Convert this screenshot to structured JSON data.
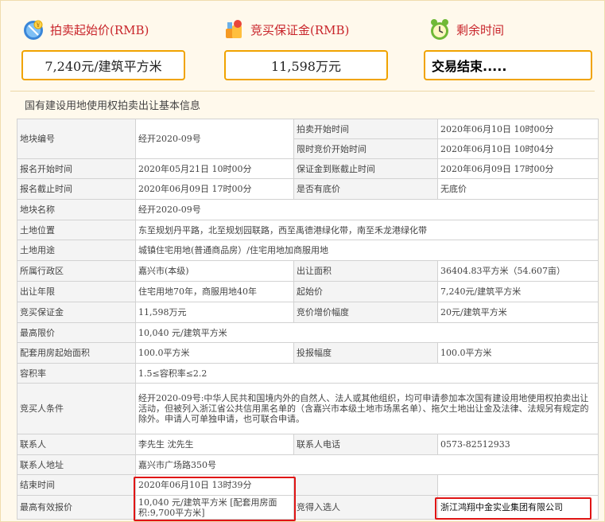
{
  "summary": {
    "start_price": {
      "label": "拍卖起始价(RMB)",
      "value": "7,240元/建筑平方米",
      "icon": "money-bag-icon"
    },
    "deposit": {
      "label": "竞买保证金(RMB)",
      "value": "11,598万元",
      "icon": "coins-icon"
    },
    "remaining": {
      "label": "剩余时间",
      "value": "交易结束.....",
      "icon": "alarm-clock-icon"
    }
  },
  "section_title": "国有建设用地使用权拍卖出让基本信息",
  "info": {
    "parcel_no_label": "地块编号",
    "parcel_no": "经开2020-09号",
    "auction_start_label": "拍卖开始时间",
    "auction_start": "2020年06月10日 10时00分",
    "limited_start_label": "限时竞价开始时间",
    "limited_start": "2020年06月10日 10时04分",
    "reg_start_label": "报名开始时间",
    "reg_start": "2020年05月21日 10时00分",
    "deposit_deadline_label": "保证金到账截止时间",
    "deposit_deadline": "2020年06月09日 17时00分",
    "reg_end_label": "报名截止时间",
    "reg_end": "2020年06月09日 17时00分",
    "reserve_label": "是否有底价",
    "reserve": "无底价",
    "parcel_name_label": "地块名称",
    "parcel_name": "经开2020-09号",
    "location_label": "土地位置",
    "location": "东至规划丹平路，北至规划园联路，西至禹德港绿化带，南至禾龙港绿化带",
    "usage_label": "土地用途",
    "usage": "城镇住宅用地(普通商品房）/住宅用地加商服用地",
    "district_label": "所属行政区",
    "district": "嘉兴市(本级)",
    "area_label": "出让面积",
    "area": "36404.83平方米（54.607亩）",
    "term_label": "出让年限",
    "term": "住宅用地70年，商服用地40年",
    "start_price_label": "起始价",
    "start_price": "7,240元/建筑平方米",
    "deposit_label": "竞买保证金",
    "deposit": "11,598万元",
    "increment_label": "竞价增价幅度",
    "increment": "20元/建筑平方米",
    "max_price_label": "最高限价",
    "max_price": "10,040 元/建筑平方米",
    "housing_start_label": "配套用房起始面积",
    "housing_start": "100.0平方米",
    "bid_step_label": "投报幅度",
    "bid_step": "100.0平方米",
    "far_label": "容积率",
    "far": "1.5≤容积率≤2.2",
    "bidder_cond_label": "竞买人条件",
    "bidder_cond": "经开2020-09号:中华人民共和国境内外的自然人、法人或其他组织，均可申请参加本次国有建设用地使用权拍卖出让活动，但被列入浙江省公共信用黑名单的（含嘉兴市本级土地市场黑名单）、拖欠土地出让金及法律、法规另有规定的除外。申请人可单独申请，也可联合申请。",
    "contact_label": "联系人",
    "contact": "李先生 沈先生",
    "phone_label": "联系人电话",
    "phone": "0573-82512933",
    "address_label": "联系人地址",
    "address": "嘉兴市广场路350号",
    "end_time_label": "结束时间",
    "end_time": "2020年06月10日 13时39分",
    "top_bid_label": "最高有效报价",
    "top_bid": "10,040 元/建筑平方米 [配套用房面积:9,700平方米]",
    "winner_label": "竞得入选人",
    "winner": "浙江鸿翔中金实业集团有限公司"
  }
}
